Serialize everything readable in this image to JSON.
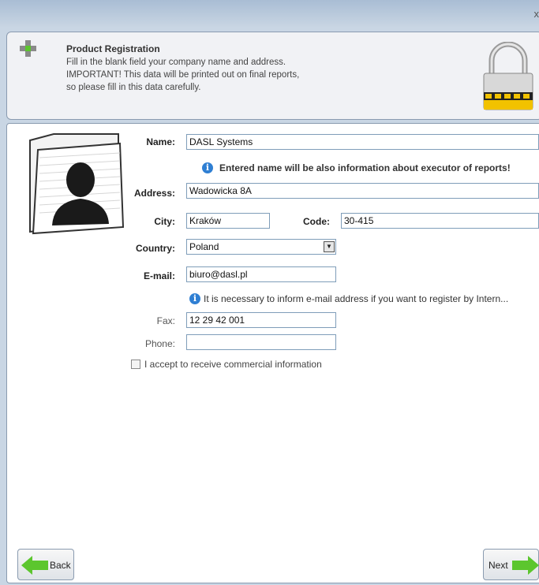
{
  "window": {
    "close_glyph": "x"
  },
  "header": {
    "title": "Product Registration",
    "lines": [
      "Fill in the blank field your company name and address.",
      "IMPORTANT! This data will be printed out on final reports,",
      "so please fill in this data carefully."
    ],
    "icon_left": "green-plus-icon",
    "icon_right": "padlock-icon"
  },
  "form": {
    "name_label": "Name:",
    "name_value": "DASL Systems",
    "name_note": "Entered name will be also information about executor of reports!",
    "address_label": "Address:",
    "address_value": "Wadowicka 8A",
    "city_label": "City:",
    "city_value": "Kraków",
    "code_label": "Code:",
    "code_value": "30-415",
    "country_label": "Country:",
    "country_value": "Poland",
    "email_label": "E-mail:",
    "email_value": "biuro@dasl.pl",
    "email_note": "It is necessary to inform e-mail address if you want to register by Intern...",
    "fax_label": "Fax:",
    "fax_value": "12 29 42 001",
    "phone_label": "Phone:",
    "phone_value": "",
    "commercial_checkbox_label": "I accept to receive commercial information",
    "commercial_checked": false,
    "info_glyph": "i"
  },
  "nav": {
    "back_label": "Back",
    "next_label": "Next"
  },
  "colors": {
    "accent_green": "#5cc62e",
    "info_blue": "#2f7fd3",
    "lock_yellow": "#f2c200"
  }
}
